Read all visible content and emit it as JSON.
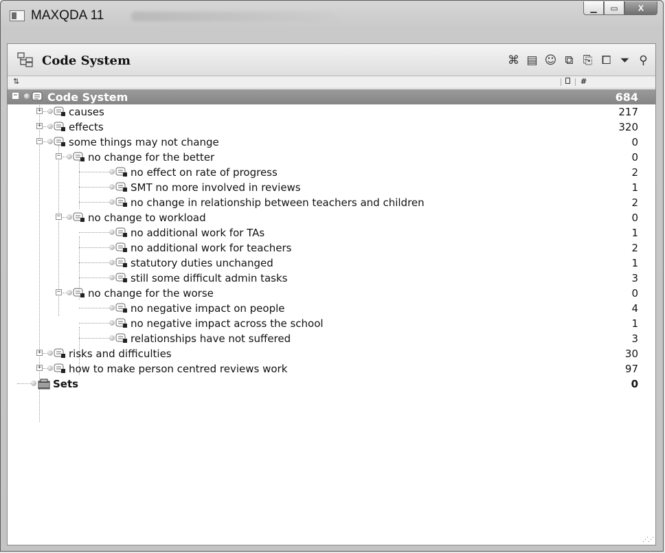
{
  "window": {
    "title": "MAXQDA 11"
  },
  "panel": {
    "title": "Code System"
  },
  "toolbar": {
    "icons": [
      "activate-codes-icon",
      "code-memo-icon",
      "emoticon-icon",
      "code-map-icon",
      "new-code-icon",
      "sets-icon",
      "code-filter-icon",
      "search-icon"
    ]
  },
  "tree": {
    "root": {
      "label": "Code System",
      "count": "684"
    },
    "causes": {
      "label": "causes",
      "count": "217"
    },
    "effects": {
      "label": "effects",
      "count": "320"
    },
    "some_things": {
      "label": "some things may not change",
      "count": "0"
    },
    "better": {
      "label": "no change for the better",
      "count": "0"
    },
    "better_1": {
      "label": "no effect on rate of progress",
      "count": "2"
    },
    "better_2": {
      "label": "SMT no more involved in reviews",
      "count": "1"
    },
    "better_3": {
      "label": "no change in relationship between teachers and children",
      "count": "2"
    },
    "workload": {
      "label": "no change to workload",
      "count": "0"
    },
    "workload_1": {
      "label": "no additional work for TAs",
      "count": "1"
    },
    "workload_2": {
      "label": "no additional work for teachers",
      "count": "2"
    },
    "workload_3": {
      "label": "statutory duties unchanged",
      "count": "1"
    },
    "workload_4": {
      "label": "still some difficult admin tasks",
      "count": "3"
    },
    "worse": {
      "label": "no change for the worse",
      "count": "0"
    },
    "worse_1": {
      "label": "no negative impact on people",
      "count": "4"
    },
    "worse_2": {
      "label": "no negative impact across the school",
      "count": "1"
    },
    "worse_3": {
      "label": "relationships have not suffered",
      "count": "3"
    },
    "risks": {
      "label": "risks and difficulties",
      "count": "30"
    },
    "howto": {
      "label": "how to make person centred reviews work",
      "count": "97"
    },
    "sets": {
      "label": "Sets",
      "count": "0"
    }
  },
  "colors": {
    "root_row": "#8e8e8e",
    "window_frame": "#c8c8c8"
  }
}
